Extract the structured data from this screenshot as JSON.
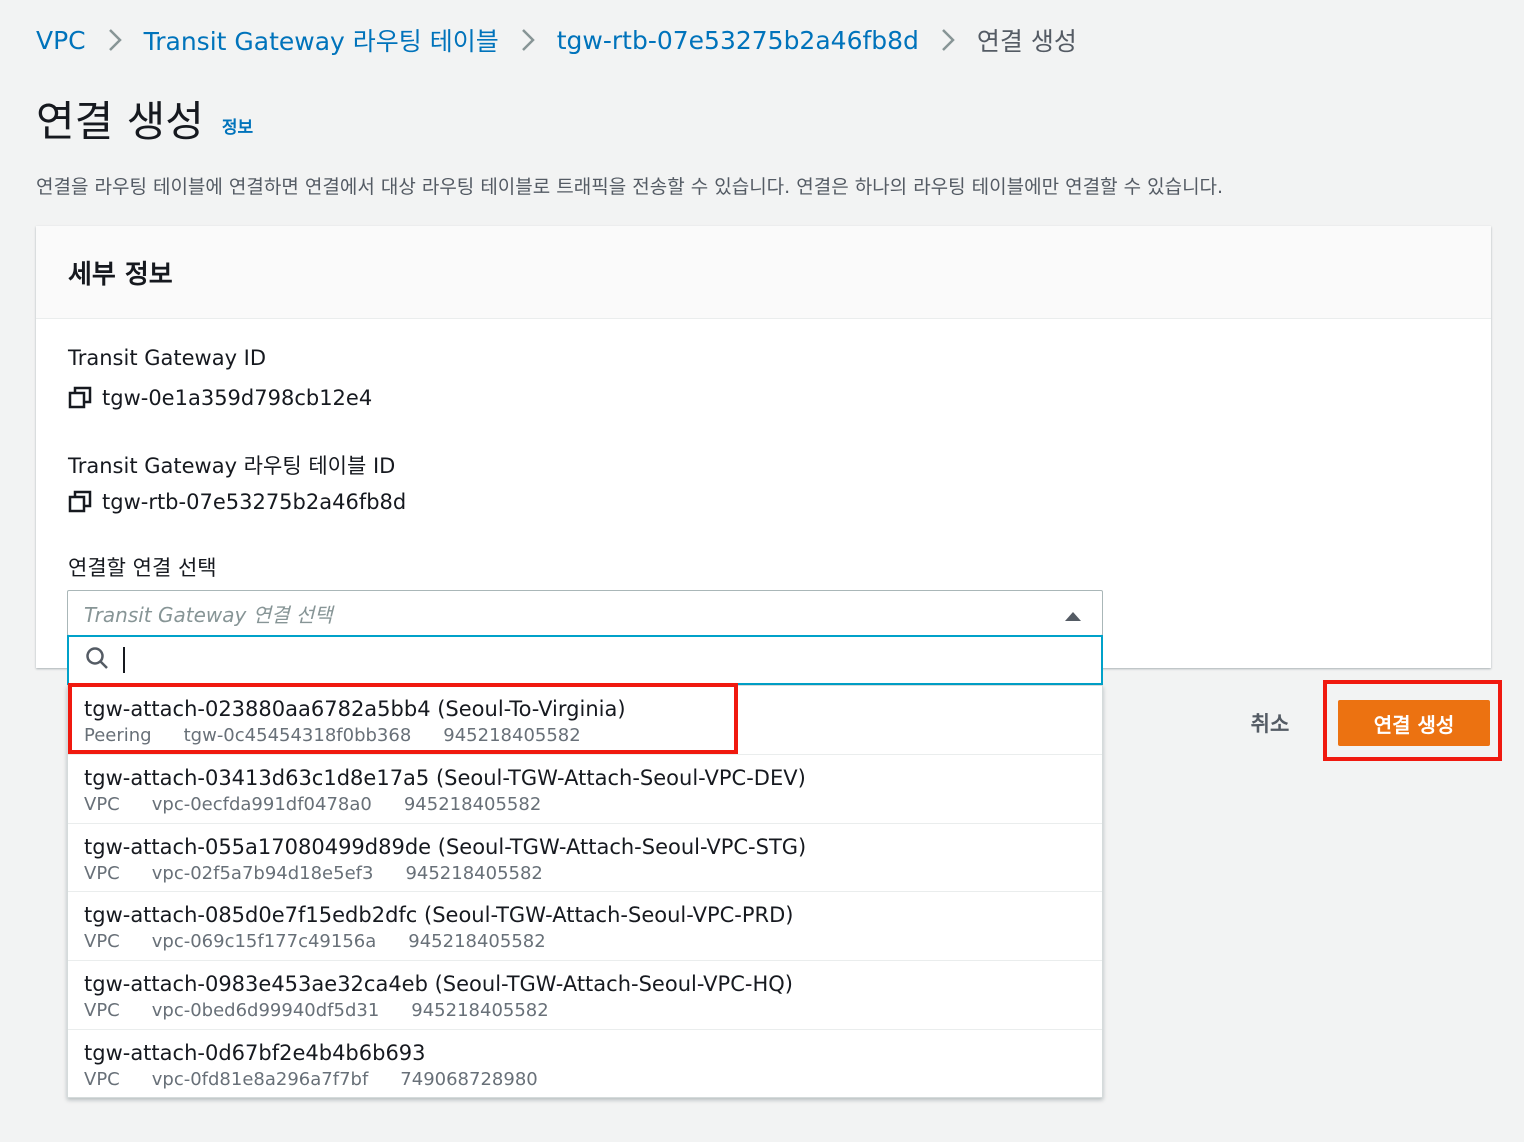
{
  "breadcrumb": {
    "items": [
      "VPC",
      "Transit Gateway 라우팅 테이블",
      "tgw-rtb-07e53275b2a46fb8d"
    ],
    "current": "연결 생성"
  },
  "page": {
    "title": "연결 생성",
    "info_link": "정보",
    "description": "연결을 라우팅 테이블에 연결하면 연결에서 대상 라우팅 테이블로 트래픽을 전송할 수 있습니다. 연결은 하나의 라우팅 테이블에만 연결할 수 있습니다."
  },
  "panel": {
    "title": "세부 정보",
    "tgw_id_label": "Transit Gateway ID",
    "tgw_id_value": "tgw-0e1a359d798cb12e4",
    "rtb_id_label": "Transit Gateway 라우팅 테이블 ID",
    "rtb_id_value": "tgw-rtb-07e53275b2a46fb8d",
    "select_label": "연결할 연결 선택",
    "select_placeholder": "Transit Gateway 연결 선택"
  },
  "search": {
    "value": ""
  },
  "options": [
    {
      "title": "tgw-attach-023880aa6782a5bb4 (Seoul-To-Virginia)",
      "type": "Peering",
      "resource": "tgw-0c45454318f0bb368",
      "account": "945218405582"
    },
    {
      "title": "tgw-attach-03413d63c1d8e17a5 (Seoul-TGW-Attach-Seoul-VPC-DEV)",
      "type": "VPC",
      "resource": "vpc-0ecfda991df0478a0",
      "account": "945218405582"
    },
    {
      "title": "tgw-attach-055a17080499d89de (Seoul-TGW-Attach-Seoul-VPC-STG)",
      "type": "VPC",
      "resource": "vpc-02f5a7b94d18e5ef3",
      "account": "945218405582"
    },
    {
      "title": "tgw-attach-085d0e7f15edb2dfc (Seoul-TGW-Attach-Seoul-VPC-PRD)",
      "type": "VPC",
      "resource": "vpc-069c15f177c49156a",
      "account": "945218405582"
    },
    {
      "title": "tgw-attach-0983e453ae32ca4eb (Seoul-TGW-Attach-Seoul-VPC-HQ)",
      "type": "VPC",
      "resource": "vpc-0bed6d99940df5d31",
      "account": "945218405582"
    },
    {
      "title": "tgw-attach-0d67bf2e4b4b6b693",
      "type": "VPC",
      "resource": "vpc-0fd81e8a296a7f7bf",
      "account": "749068728980"
    }
  ],
  "actions": {
    "cancel": "취소",
    "create": "연결 생성"
  },
  "colors": {
    "link": "#0073bb",
    "primary": "#ec7211",
    "focus": "#00a1c9",
    "highlight": "#f0190f"
  }
}
